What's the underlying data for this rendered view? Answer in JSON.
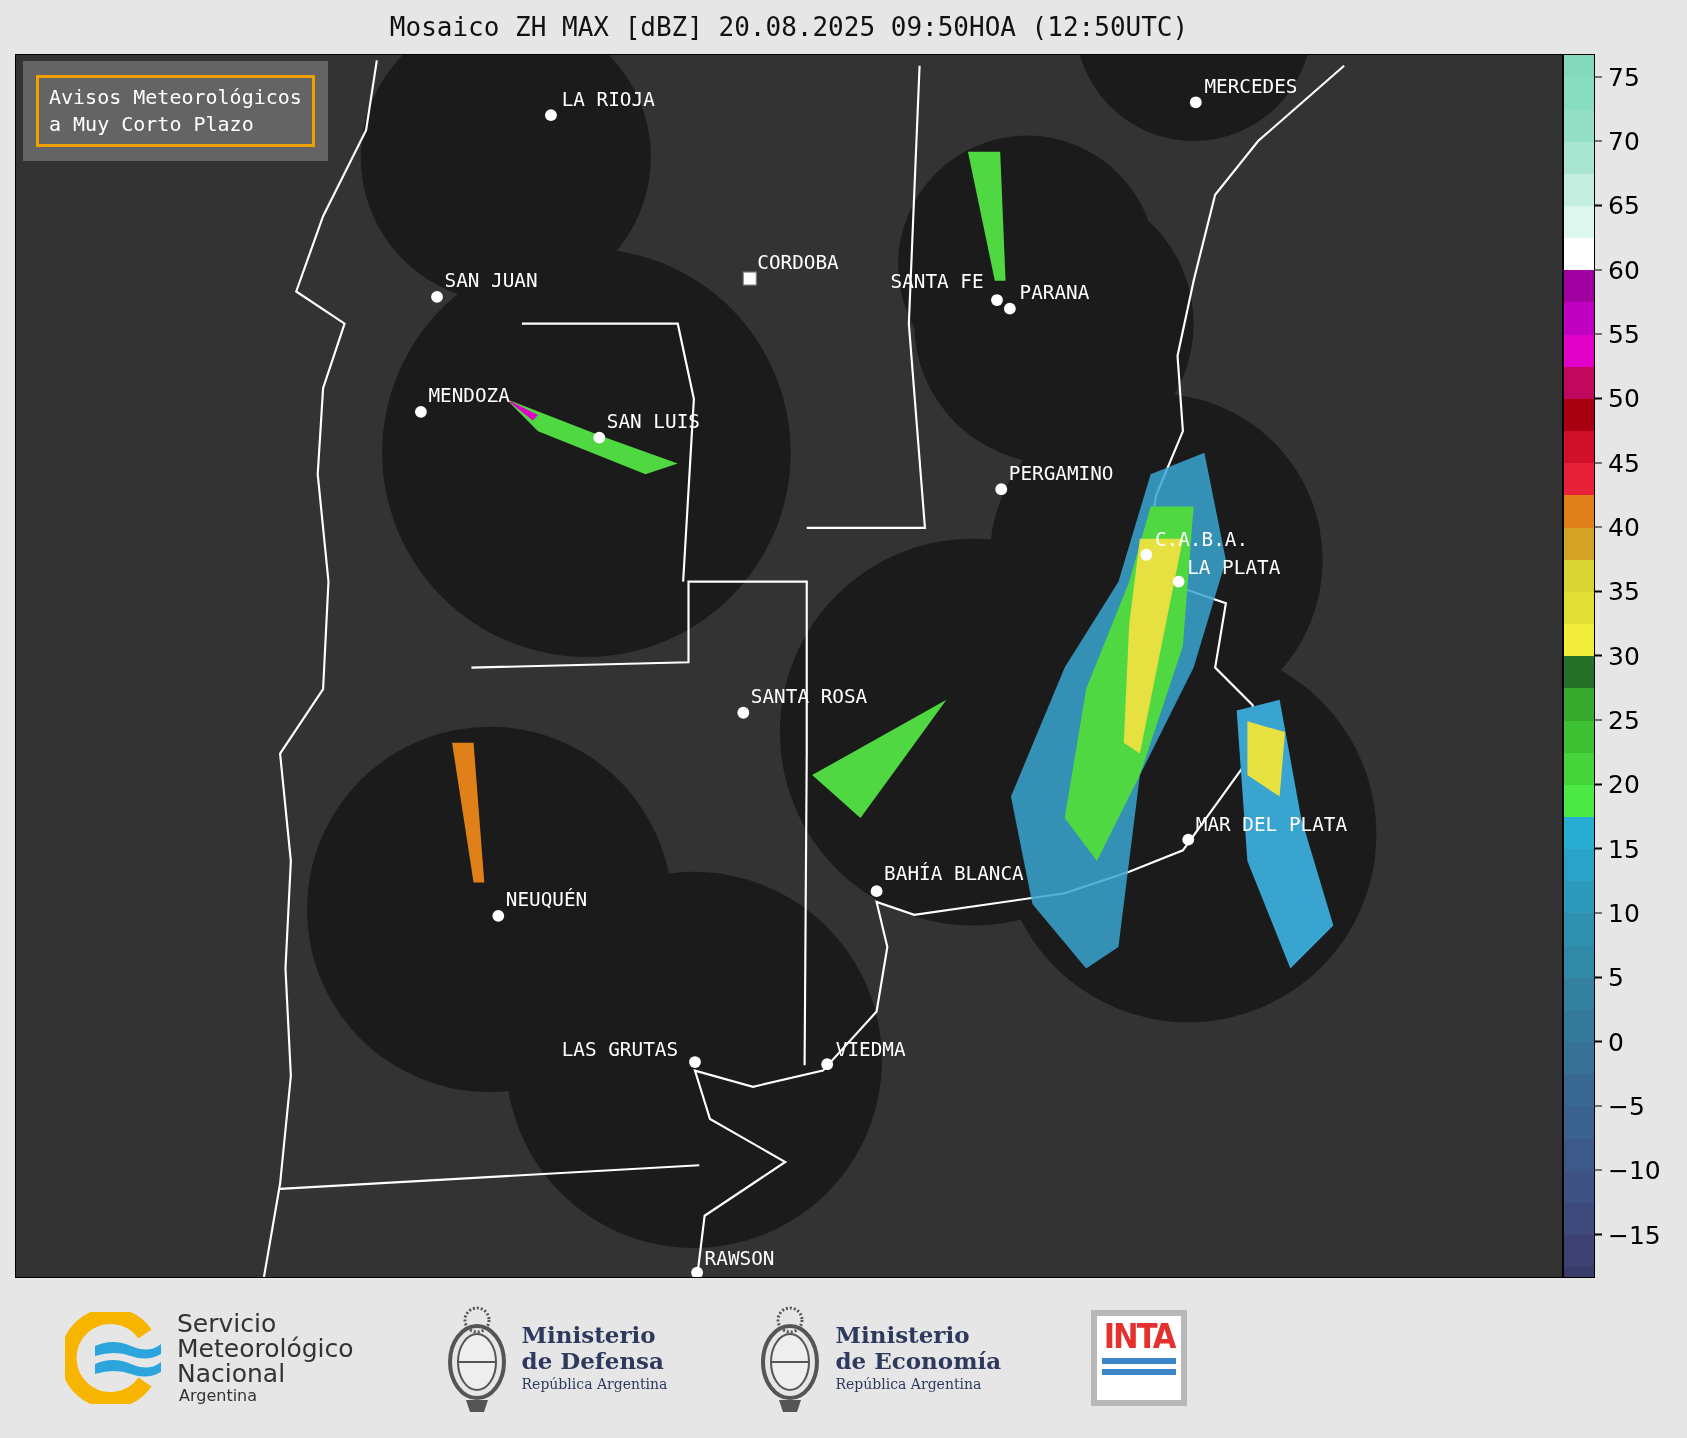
{
  "title": "Mosaico ZH MAX [dBZ] 20.08.2025 09:50HOA (12:50UTC)",
  "notice": {
    "lines": [
      "Avisos Meteorológicos",
      "a Muy Corto Plazo"
    ]
  },
  "cities": [
    {
      "name": "LA RIOJA",
      "kind": "dot"
    },
    {
      "name": "MERCEDES",
      "kind": "dot"
    },
    {
      "name": "CORDOBA",
      "kind": "square"
    },
    {
      "name": "SAN JUAN",
      "kind": "dot"
    },
    {
      "name": "SANTA FE",
      "kind": "dot"
    },
    {
      "name": "PARANA",
      "kind": "dot"
    },
    {
      "name": "MENDOZA",
      "kind": "dot"
    },
    {
      "name": "SAN LUIS",
      "kind": "dot"
    },
    {
      "name": "PERGAMINO",
      "kind": "dot"
    },
    {
      "name": "C.A.B.A.",
      "kind": "dot"
    },
    {
      "name": "LA PLATA",
      "kind": "dot"
    },
    {
      "name": "SANTA ROSA",
      "kind": "dot"
    },
    {
      "name": "MAR DEL PLATA",
      "kind": "dot"
    },
    {
      "name": "BAHÍA BLANCA",
      "kind": "dot"
    },
    {
      "name": "NEUQUÉN",
      "kind": "dot"
    },
    {
      "name": "LAS GRUTAS",
      "kind": "dot"
    },
    {
      "name": "VIEDMA",
      "kind": "dot"
    },
    {
      "name": "RAWSON",
      "kind": "dot"
    }
  ],
  "colorbar": {
    "ticks": [
      "75",
      "70",
      "65",
      "60",
      "55",
      "50",
      "45",
      "40",
      "35",
      "30",
      "25",
      "20",
      "15",
      "10",
      "5",
      "0",
      "−5",
      "−10",
      "−15"
    ],
    "steps": [
      {
        "color": "#3a3c6a"
      },
      {
        "color": "#3d4272"
      },
      {
        "color": "#3e4a7c"
      },
      {
        "color": "#3e5284"
      },
      {
        "color": "#3d598a"
      },
      {
        "color": "#3b618e"
      },
      {
        "color": "#396992"
      },
      {
        "color": "#377196"
      },
      {
        "color": "#35799a"
      },
      {
        "color": "#33819e"
      },
      {
        "color": "#3089a6"
      },
      {
        "color": "#2e91b0"
      },
      {
        "color": "#2b9abc"
      },
      {
        "color": "#29a4c8"
      },
      {
        "color": "#28aed4"
      },
      {
        "color": "#4ce843"
      },
      {
        "color": "#45d43a"
      },
      {
        "color": "#3ec033"
      },
      {
        "color": "#37aa2d"
      },
      {
        "color": "#26702a"
      },
      {
        "color": "#f2ec3a"
      },
      {
        "color": "#e2de36"
      },
      {
        "color": "#d8d432"
      },
      {
        "color": "#d4a224"
      },
      {
        "color": "#e08018"
      },
      {
        "color": "#e82038"
      },
      {
        "color": "#d0102a"
      },
      {
        "color": "#a80010"
      },
      {
        "color": "#c0085c"
      },
      {
        "color": "#e000c8"
      },
      {
        "color": "#c000c0"
      },
      {
        "color": "#a000a0"
      },
      {
        "color": "#ffffff"
      },
      {
        "color": "#ddf6ee"
      },
      {
        "color": "#c4efe0"
      },
      {
        "color": "#a8e6d2"
      },
      {
        "color": "#94e0c6"
      },
      {
        "color": "#88dcc0"
      },
      {
        "color": "#84d8bc"
      }
    ]
  },
  "logos": [
    {
      "kind": "smn",
      "lines": [
        "Servicio",
        "Meteorológico",
        "Nacional",
        "Argentina"
      ]
    },
    {
      "kind": "ministry",
      "lines": [
        "Ministerio",
        "de Defensa",
        "República Argentina"
      ]
    },
    {
      "kind": "ministry",
      "lines": [
        "Ministerio",
        "de Economía",
        "República Argentina"
      ]
    },
    {
      "kind": "inta",
      "lines": [
        "INTA"
      ]
    }
  ]
}
